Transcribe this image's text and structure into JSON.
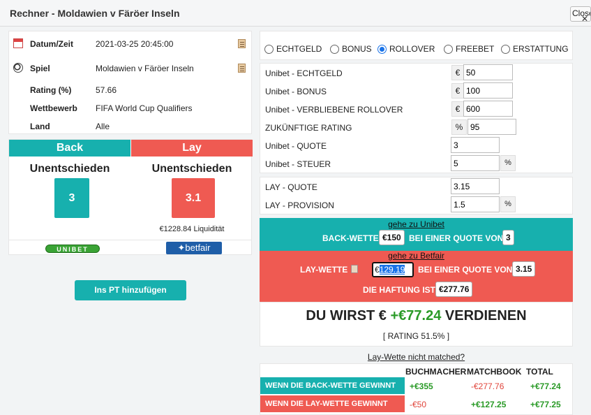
{
  "window": {
    "title": "Rechner - Moldawien v Färöer Inseln",
    "close_label": "Close"
  },
  "info": {
    "rows": [
      {
        "label": "Datum/Zeit",
        "value": "2021-03-25 20:45:00",
        "icon": "calendar-icon",
        "copy": true
      },
      {
        "label": "Spiel",
        "value": "Moldawien v Färöer Inseln",
        "icon": "football-icon",
        "copy": true
      },
      {
        "label": "Rating (%)",
        "value": "57.66"
      },
      {
        "label": "Wettbewerb",
        "value": "FIFA World Cup Qualifiers"
      },
      {
        "label": "Land",
        "value": "Alle"
      }
    ]
  },
  "odds": {
    "back_header": "Back",
    "lay_header": "Lay",
    "back_selection": "Unentschieden",
    "lay_selection": "Unentschieden",
    "back_odds": "3",
    "lay_odds": "3.1",
    "liquidity": "€1228.84 Liquidität",
    "back_logo": "UNIBET",
    "lay_logo": "betfair",
    "back_color": "#17b0ae",
    "lay_color": "#ef5a52"
  },
  "pt_button": "Ins PT hinzufügen",
  "bet_types": [
    {
      "label": "ECHTGELD",
      "selected": false
    },
    {
      "label": "BONUS",
      "selected": false
    },
    {
      "label": "ROLLOVER",
      "selected": true
    },
    {
      "label": "FREEBET",
      "selected": false
    },
    {
      "label": "ERSTATTUNG",
      "selected": false
    }
  ],
  "fields": {
    "echtgeld": {
      "label": "Unibet - ECHTGELD",
      "prefix": "€",
      "value": "50"
    },
    "bonus": {
      "label": "Unibet - BONUS",
      "prefix": "€",
      "value": "100"
    },
    "rollover": {
      "label": "Unibet - VERBLIEBENE ROLLOVER",
      "prefix": "€",
      "value": "600"
    },
    "rating": {
      "label": "ZUKÜNFTIGE RATING",
      "prefix": "%",
      "value": "95"
    },
    "quote": {
      "label": "Unibet - QUOTE",
      "value": "3"
    },
    "steuer": {
      "label": "Unibet - STEUER",
      "value": "5",
      "suffix": "%"
    },
    "lay_quote": {
      "label": "LAY - QUOTE",
      "value": "3.15"
    },
    "lay_provision": {
      "label": "LAY - PROVISION",
      "value": "1.5",
      "suffix": "%"
    }
  },
  "back_band": {
    "link": "gehe zu Unibet",
    "text1": "BACK-WETTE",
    "stake": "€150",
    "text2": "BEI EINER QUOTE VON",
    "odds": "3"
  },
  "lay_band": {
    "link": "gehe zu Betfair",
    "text1": "LAY-WETTE",
    "currency": "€",
    "stake": "129.19",
    "text2": "BEI EINER QUOTE VON",
    "odds": "3.15",
    "liability_text": "DIE HAFTUNG IST",
    "liability": "€277.76"
  },
  "result": {
    "prefix": "DU WIRST €",
    "amount": "+€77.24",
    "suffix": "VERDIENEN",
    "rating": "[ RATING 51.5% ]"
  },
  "not_matched_link": "Lay-Wette nicht matched?",
  "table": {
    "headers": [
      "BUCHMACHER",
      "MATCHBOOK",
      "TOTAL"
    ],
    "rows": [
      {
        "label": "WENN DIE BACK-WETTE GEWINNT",
        "bookmaker": "+€355",
        "matchbook": "-€277.76",
        "total": "+€77.24"
      },
      {
        "label": "WENN DIE LAY-WETTE GEWINNT",
        "bookmaker": "-€50",
        "matchbook": "+€127.25",
        "total": "+€77.25"
      }
    ]
  }
}
